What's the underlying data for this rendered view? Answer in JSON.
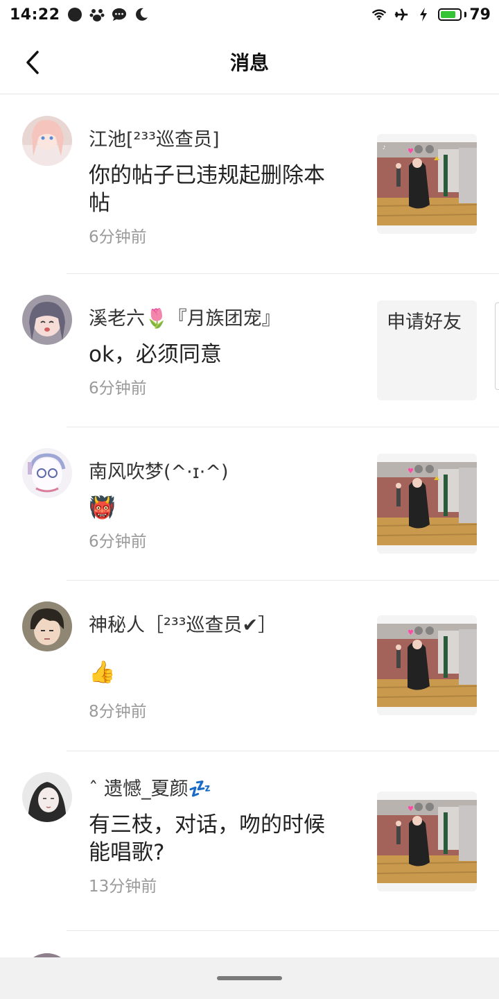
{
  "status_bar": {
    "time": "14:22",
    "battery_percent": "79",
    "battery_level": 0.79,
    "left_icons": [
      "dot-icon",
      "paw-icon",
      "chat-icon",
      "moon-icon"
    ],
    "right_icons": [
      "wifi-icon",
      "airplane-icon",
      "charging-icon"
    ]
  },
  "header": {
    "title": "消息",
    "back_icon": "chevron-left-icon"
  },
  "messages": [
    {
      "name": "江池[²³³巡查员]",
      "text": "你的帖子已违规起删除本帖",
      "time": "6分钟前",
      "attachment": "image"
    },
    {
      "name": "溪老六🌷『月族团宠』",
      "text": "ok，必须同意",
      "time": "6分钟前",
      "attachment": "text",
      "attachment_text": "申请好友"
    },
    {
      "name": "南风吹梦(^·ɪ·^)",
      "text": "👹",
      "time": "6分钟前",
      "attachment": "image"
    },
    {
      "name": "神秘人［²³³巡查员✔］",
      "text": "👍",
      "time": "8分钟前",
      "attachment": "image"
    },
    {
      "name": "ˆ 遗憾_夏颜💤",
      "text": "有三枝，对话，吻的时候能唱歌?",
      "time": "13分钟前",
      "attachment": "image"
    }
  ],
  "colors": {
    "battery_fill": "#35c435",
    "divider": "#e8e8e8",
    "muted_text": "#9a9a9a"
  }
}
